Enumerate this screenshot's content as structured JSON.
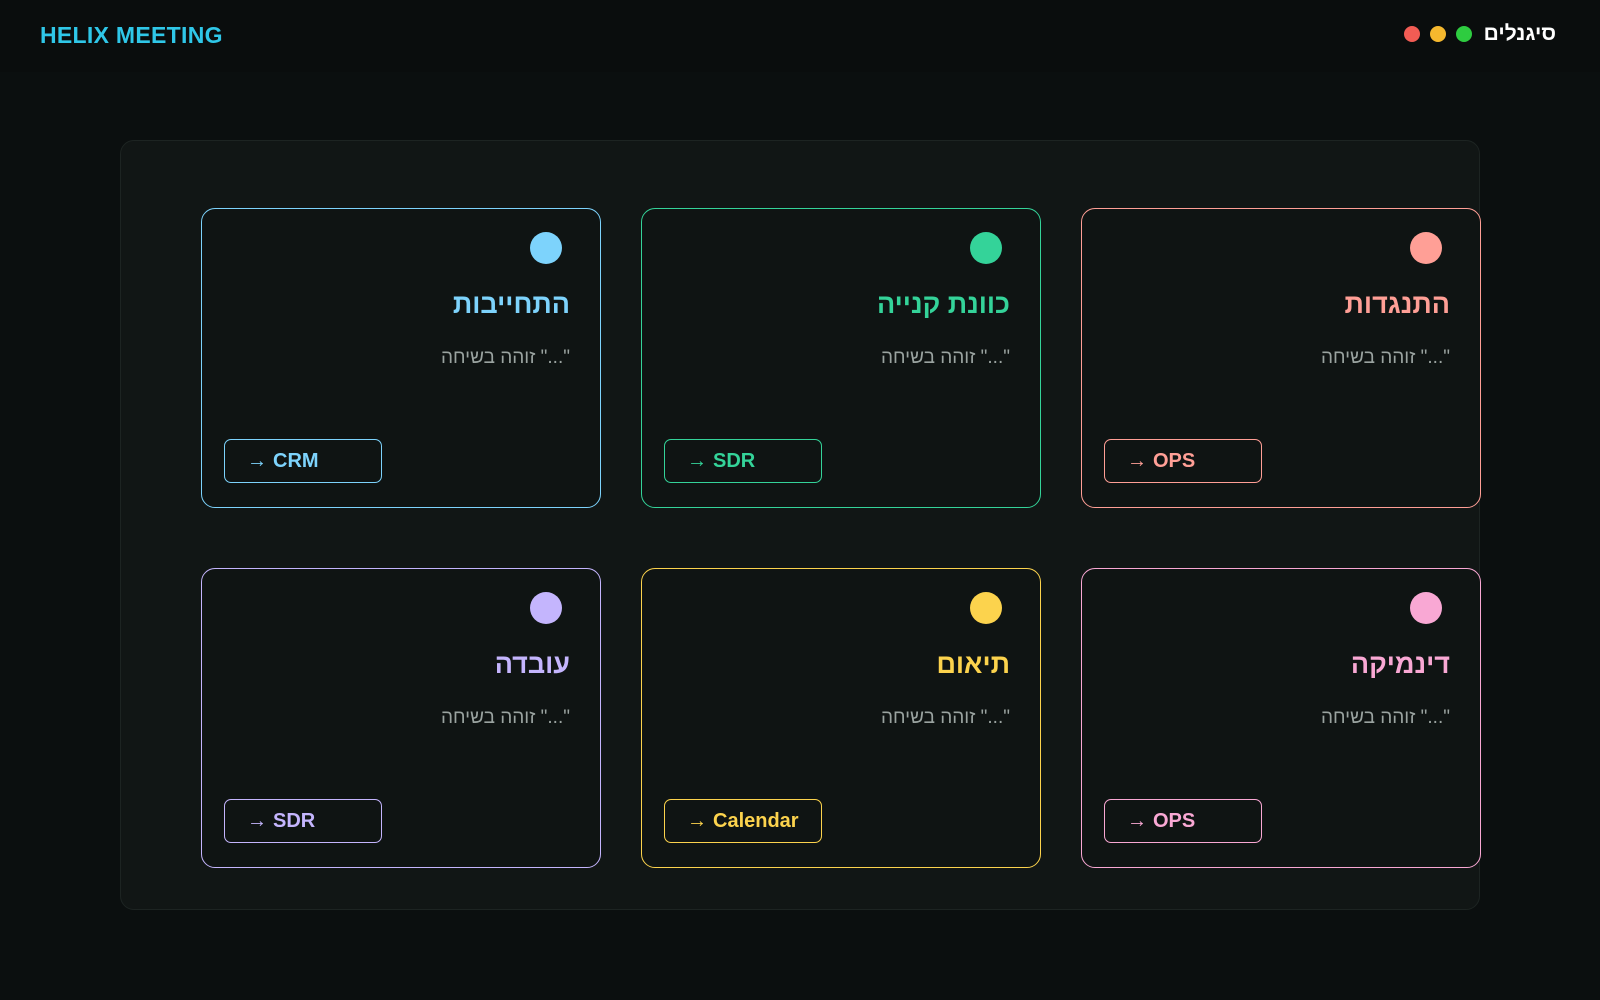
{
  "header": {
    "brand": "HELIX MEETING",
    "signals_label": "סיגנלים",
    "dots": [
      {
        "name": "green-dot",
        "color": "#2ecc40"
      },
      {
        "name": "amber-dot",
        "color": "#f5b82e"
      },
      {
        "name": "red-dot",
        "color": "#f25c54"
      }
    ]
  },
  "cards": [
    {
      "title": "התנגדות",
      "desc": "\"...\" זוהה בשיחה",
      "button": "OPS",
      "color": "#ff9f96"
    },
    {
      "title": "כוונת קנייה",
      "desc": "\"...\" זוהה בשיחה",
      "button": "SDR",
      "color": "#34d399"
    },
    {
      "title": "התחייבות",
      "desc": "\"...\" זוהה בשיחה",
      "button": "CRM",
      "color": "#7dd3fc"
    },
    {
      "title": "דינמיקה",
      "desc": "\"...\" זוהה בשיחה",
      "button": "OPS",
      "color": "#f9a8d4"
    },
    {
      "title": "תיאום",
      "desc": "\"...\" זוהה בשיחה",
      "button": "Calendar",
      "color": "#fcd34d"
    },
    {
      "title": "עובדה",
      "desc": "\"...\" זוהה בשיחה",
      "button": "SDR",
      "color": "#c4b5fd"
    }
  ]
}
